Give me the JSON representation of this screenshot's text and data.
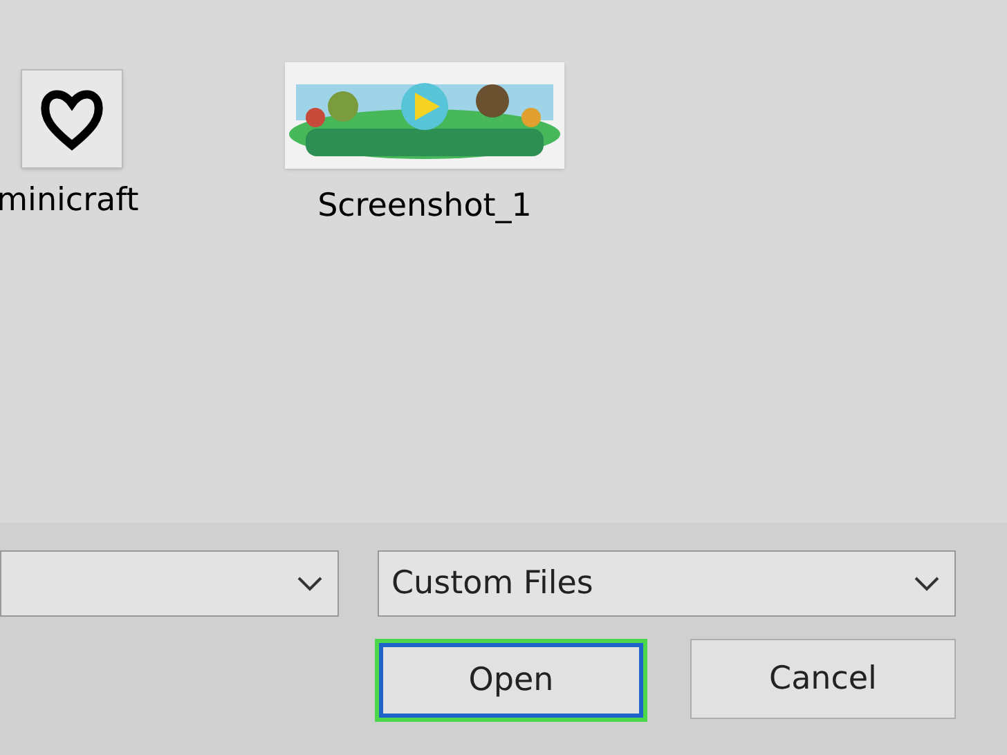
{
  "files": [
    {
      "name": "minicraft",
      "kind": "icon"
    },
    {
      "name": "Screenshot_1",
      "kind": "picture"
    }
  ],
  "file_type": {
    "value": "Custom Files"
  },
  "buttons": [
    {
      "label": "Open",
      "focused": true
    },
    {
      "label": "Cancel",
      "focused": false
    }
  ]
}
